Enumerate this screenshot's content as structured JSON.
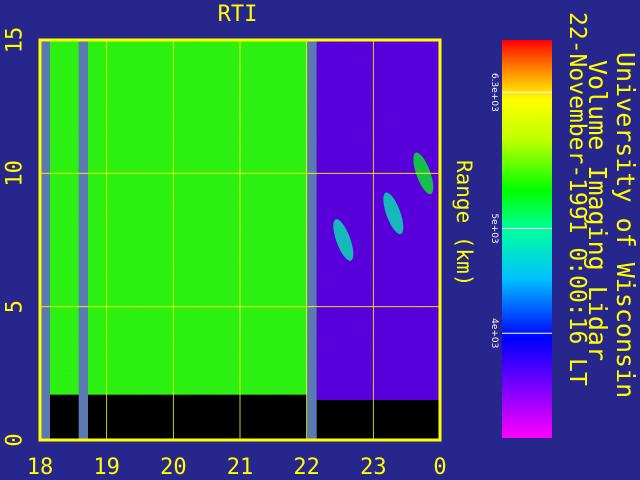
{
  "chart_data": {
    "type": "heatmap",
    "title": "RTI",
    "ylabel": "Range (km)",
    "xlabel": "",
    "x_ticks": [
      "18",
      "19",
      "20",
      "21",
      "22",
      "23",
      "0"
    ],
    "y_ticks": [
      "0",
      "5",
      "10",
      "15"
    ],
    "xlim": [
      18,
      24
    ],
    "ylim": [
      0,
      15
    ],
    "grid": true,
    "colorbar": {
      "ticks": [
        {
          "label": "4e+03",
          "value": 4000
        },
        {
          "label": "5e+03",
          "value": 5000
        },
        {
          "label": "6.3e+03",
          "value": 6300
        }
      ],
      "range": [
        3000,
        6800
      ]
    },
    "data_gaps_hours": [
      [
        18.0,
        18.15
      ],
      [
        18.58,
        18.72
      ],
      [
        22.0,
        22.15
      ]
    ],
    "segments": [
      {
        "x_start": 18.15,
        "x_end": 22.0,
        "value": 5300,
        "min_range_km": 1.7
      },
      {
        "x_start": 22.15,
        "x_end": 24.0,
        "value": 3750,
        "min_range_km": 1.5
      }
    ],
    "cloud_features": [
      {
        "x": 22.55,
        "y": 7.5,
        "value": 4900
      },
      {
        "x": 23.3,
        "y": 8.5,
        "value": 4900
      },
      {
        "x": 23.75,
        "y": 10.0,
        "value": 5300
      }
    ]
  },
  "header": {
    "line1": "University of Wisconsin",
    "line2": "Volume Imaging Lidar",
    "line3": "22-November-1991  0:00:16 LT"
  },
  "colors": {
    "background": "#26268c",
    "axis": "#ffff00",
    "gap": "#5a7ab4",
    "no_data": "#000000"
  }
}
